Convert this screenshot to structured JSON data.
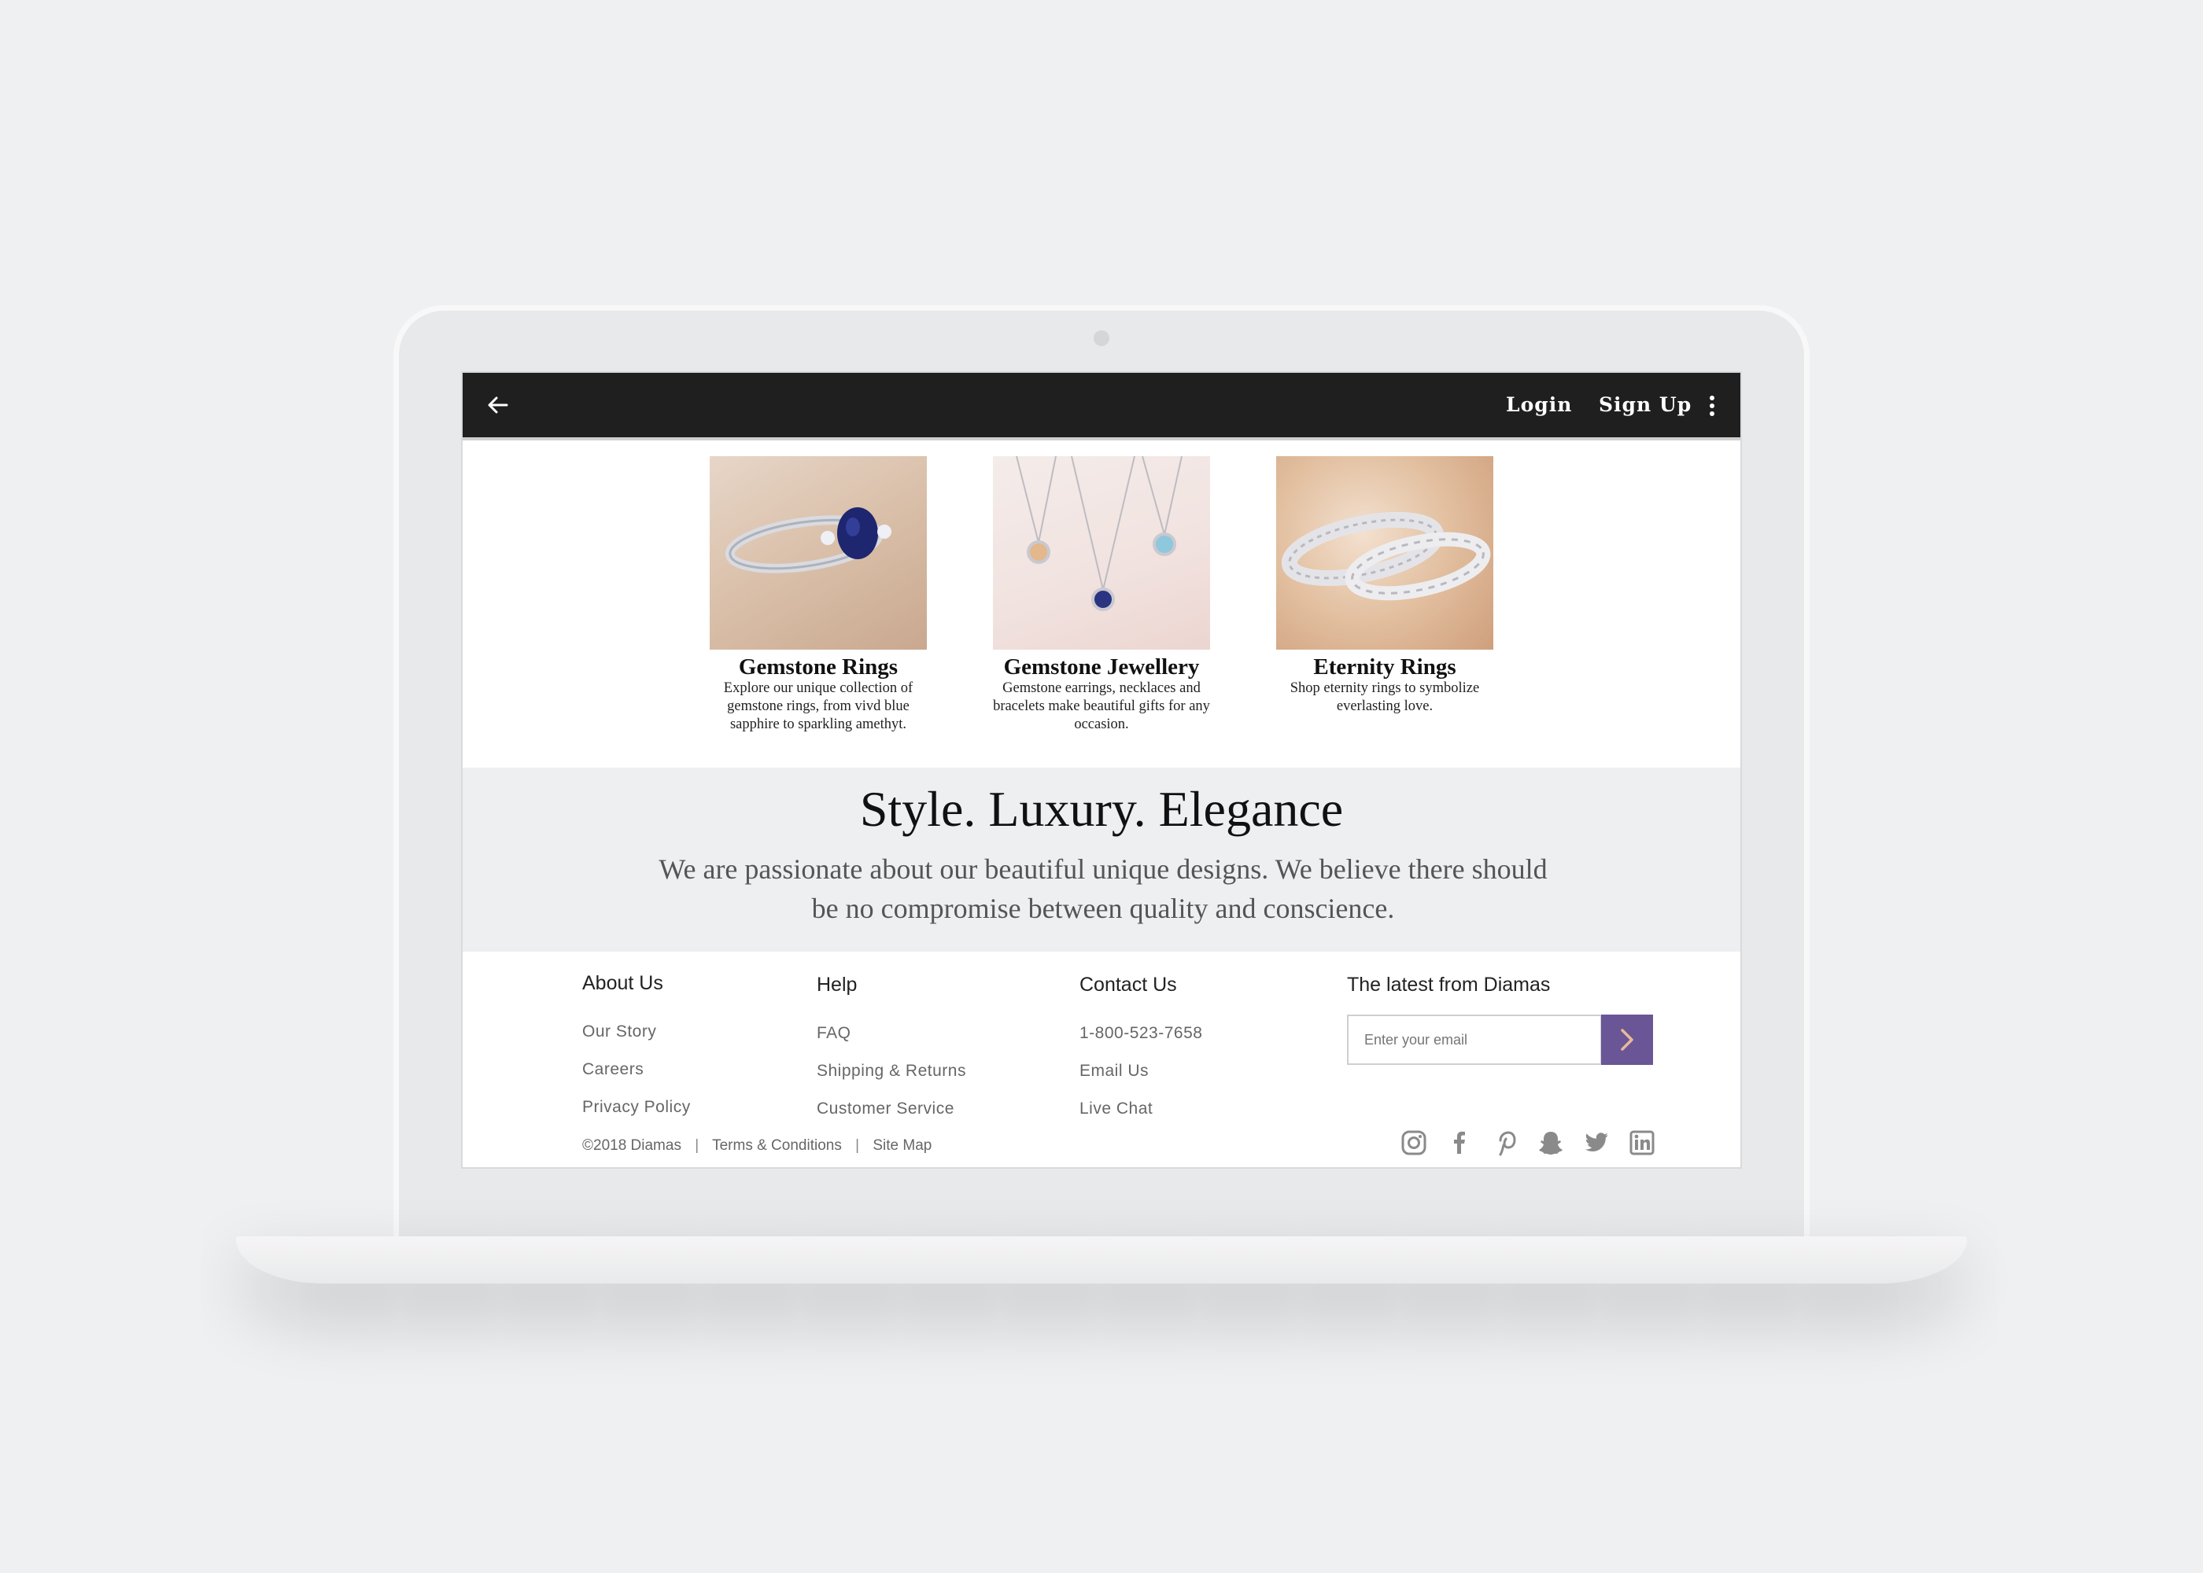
{
  "header": {
    "login_label": "Login",
    "signup_label": "Sign Up"
  },
  "products": [
    {
      "title": "Gemstone Rings",
      "desc_lines": [
        "Explore our unique collection of",
        "gemstone rings, from vivd blue",
        "sapphire to sparkling amethyt."
      ]
    },
    {
      "title": "Gemstone Jewellery",
      "desc_lines": [
        "Gemstone earrings, necklaces and",
        "bracelets make beautiful gifts for any",
        "occasion."
      ]
    },
    {
      "title": "Eternity Rings",
      "desc_lines": [
        "Shop eternity rings to symbolize",
        "everlasting love."
      ]
    }
  ],
  "hero": {
    "title": "Style. Luxury. Elegance",
    "text_lines": [
      "We are passionate about our beautiful unique designs. We  believe there should",
      "be no compromise between quality and conscience."
    ]
  },
  "footer": {
    "about": {
      "heading": "About Us",
      "links": [
        "Our Story",
        "Careers",
        "Privacy Policy"
      ]
    },
    "help": {
      "heading": "Help",
      "links": [
        "FAQ",
        "Shipping & Returns",
        "Customer Service"
      ]
    },
    "contact": {
      "heading": "Contact Us",
      "links": [
        "1-800-523-7658",
        "Email Us",
        "Live Chat"
      ]
    },
    "newsletter": {
      "heading": "The latest from Diamas",
      "placeholder": "Enter your email"
    },
    "copyright": "©2018 Diamas",
    "terms": "Terms & Conditions",
    "sitemap": "Site Map",
    "separator": "|",
    "social_icons": [
      "instagram-icon",
      "facebook-icon",
      "pinterest-icon",
      "snapchat-icon",
      "twitter-icon",
      "linkedin-icon"
    ]
  },
  "colors": {
    "topbar": "#1f1f1f",
    "accent": "#6a5696",
    "hero_bg": "#eeeff1",
    "icon_gray": "#8a8a8a"
  }
}
